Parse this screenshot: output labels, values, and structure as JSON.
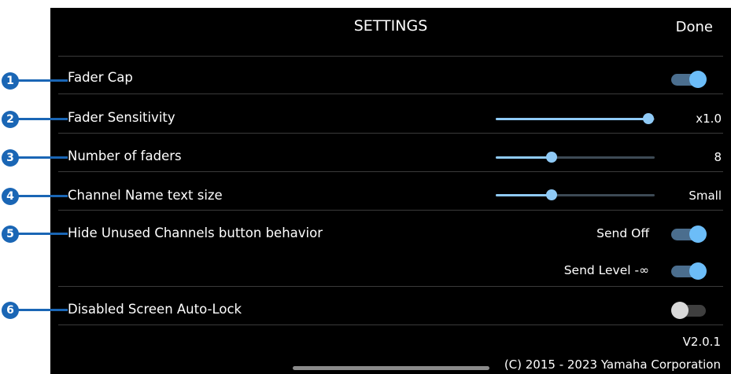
{
  "header": {
    "title": "SETTINGS",
    "done_label": "Done"
  },
  "settings": {
    "fader_cap": {
      "label": "Fader Cap",
      "on": true
    },
    "fader_sensitivity": {
      "label": "Fader Sensitivity",
      "value_text": "x1.0",
      "level": 0.96
    },
    "number_of_faders": {
      "label": "Number of faders",
      "value_text": "8",
      "level": 0.35
    },
    "channel_name_text_size": {
      "label": "Channel Name text size",
      "value_text": "Small",
      "level": 0.35
    },
    "hide_unused_channels": {
      "label": "Hide Unused Channels button behavior",
      "send_off": {
        "label": "Send Off",
        "on": true
      },
      "send_level": {
        "label": "Send Level -∞",
        "on": true
      }
    },
    "disabled_screen_auto_lock": {
      "label": "Disabled Screen Auto-Lock",
      "on": false
    }
  },
  "footer": {
    "version": "V2.0.1",
    "copyright": "(C) 2015 - 2023 Yamaha Corporation"
  },
  "callouts": [
    "1",
    "2",
    "3",
    "4",
    "5",
    "6"
  ],
  "colors": {
    "accent": "#6cbdf8",
    "callout": "#1a66b5",
    "background": "#000000"
  }
}
